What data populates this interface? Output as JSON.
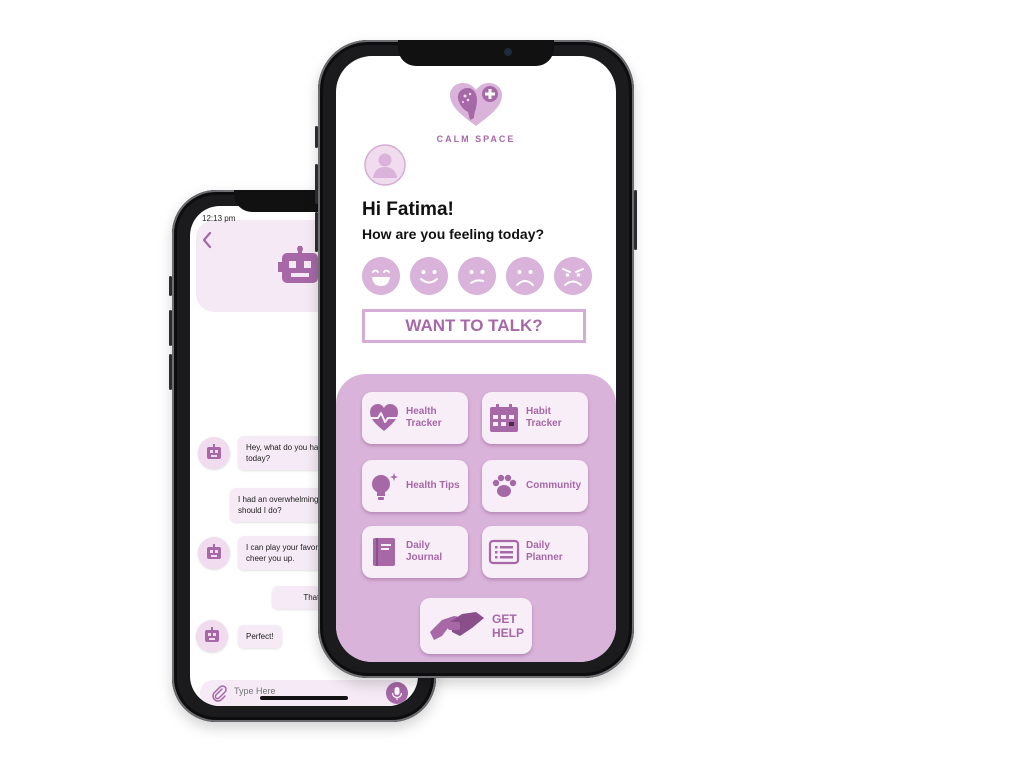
{
  "colors": {
    "accent": "#a768a7",
    "panel": "#d9b3d9",
    "tile": "#f7eef7",
    "bubble": "#f5eaf5"
  },
  "chat_screen": {
    "status_time": "12:13 pm",
    "messages": [
      {
        "from": "bot",
        "text": "Hey, what do you ha\ntoday?"
      },
      {
        "from": "user",
        "text": "I had an overwhelming\nshould I do?"
      },
      {
        "from": "bot",
        "text": "I can play your favor\ncheer you up."
      },
      {
        "from": "user",
        "text": "That so"
      },
      {
        "from": "bot",
        "text": "Perfect!"
      }
    ],
    "input_placeholder": "Type Here",
    "icons": {
      "back": "chevron-left-icon",
      "bot": "robot-icon",
      "attach": "paperclip-icon",
      "mic": "microphone-icon"
    }
  },
  "home_screen": {
    "brand": "CALM SPACE",
    "greeting": "Hi Fatima!",
    "question": "How are you feeling today?",
    "moods": [
      "very-happy-icon",
      "happy-icon",
      "unsure-icon",
      "sad-icon",
      "angry-icon"
    ],
    "talk_button": "WANT TO TALK?",
    "tiles": [
      {
        "label": "Health\nTracker",
        "icon": "heart-pulse-icon"
      },
      {
        "label": "Habit\nTracker",
        "icon": "calendar-icon"
      },
      {
        "label": "Health Tips",
        "icon": "lightbulb-icon"
      },
      {
        "label": "Community",
        "icon": "paw-icon"
      },
      {
        "label": "Daily Journal",
        "icon": "journal-icon"
      },
      {
        "label": "Daily\nPlanner",
        "icon": "planner-list-icon"
      }
    ],
    "help_button": "GET\nHELP"
  }
}
